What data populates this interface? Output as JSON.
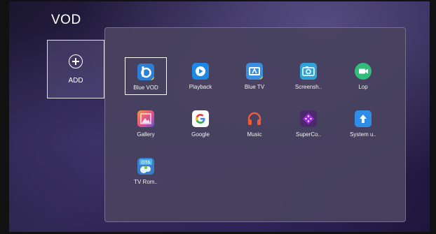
{
  "screen": {
    "title": "VOD"
  },
  "add_tile": {
    "label": "ADD",
    "icon": "plus-circle-icon"
  },
  "apps": [
    {
      "label": "Blue VOD",
      "icon": "blue-vod-icon",
      "selected": true
    },
    {
      "label": "Playback",
      "icon": "playback-icon"
    },
    {
      "label": "Blue TV",
      "icon": "blue-tv-icon"
    },
    {
      "label": "Screensh..",
      "icon": "screenshot-icon"
    },
    {
      "label": "Lop",
      "icon": "video-camera-icon"
    },
    {
      "label": "Gallery",
      "icon": "gallery-icon"
    },
    {
      "label": "Google",
      "icon": "google-icon"
    },
    {
      "label": "Music",
      "icon": "headphones-icon"
    },
    {
      "label": "SuperCo..",
      "icon": "gamepad-icon"
    },
    {
      "label": "System u..",
      "icon": "system-update-icon"
    },
    {
      "label": "TV Rom..",
      "icon": "ota-icon"
    }
  ]
}
